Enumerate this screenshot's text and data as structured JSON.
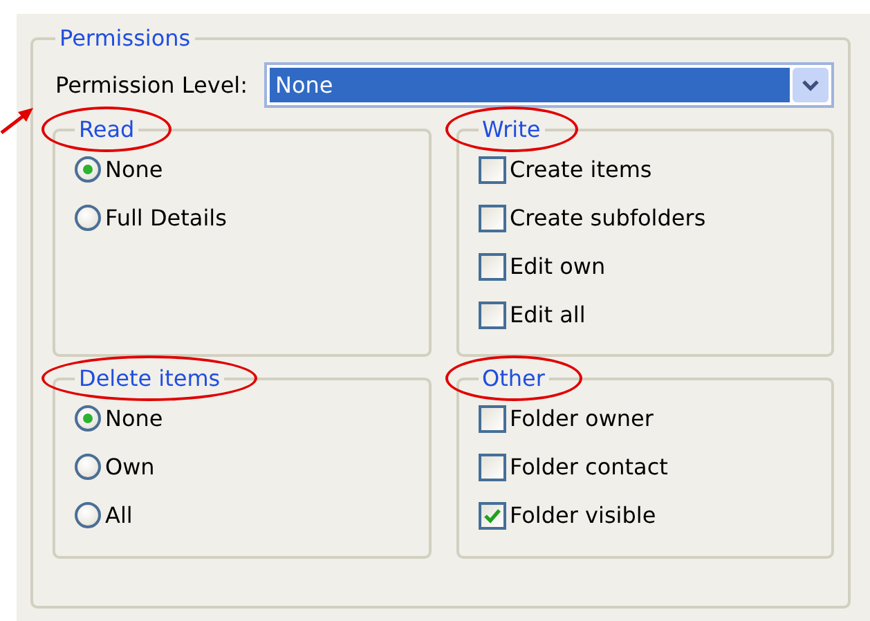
{
  "permissions": {
    "title": "Permissions",
    "level_label": "Permission Level:",
    "level_value": "None",
    "groups": [
      {
        "title": "Read",
        "kind": "radio",
        "circled": true,
        "options": [
          {
            "label": "None",
            "selected": true
          },
          {
            "label": "Full Details",
            "selected": false
          }
        ]
      },
      {
        "title": "Write",
        "kind": "checkbox",
        "circled": true,
        "options": [
          {
            "label": "Create items",
            "checked": false
          },
          {
            "label": "Create subfolders",
            "checked": false
          },
          {
            "label": "Edit own",
            "checked": false
          },
          {
            "label": "Edit all",
            "checked": false
          }
        ]
      },
      {
        "title": "Delete items",
        "kind": "radio",
        "circled": true,
        "options": [
          {
            "label": "None",
            "selected": true
          },
          {
            "label": "Own",
            "selected": false
          },
          {
            "label": "All",
            "selected": false
          }
        ]
      },
      {
        "title": "Other",
        "kind": "checkbox",
        "circled": true,
        "options": [
          {
            "label": "Folder owner",
            "checked": false
          },
          {
            "label": "Folder contact",
            "checked": false
          },
          {
            "label": "Folder visible",
            "checked": true
          }
        ]
      }
    ]
  },
  "annotation_arrow": true
}
